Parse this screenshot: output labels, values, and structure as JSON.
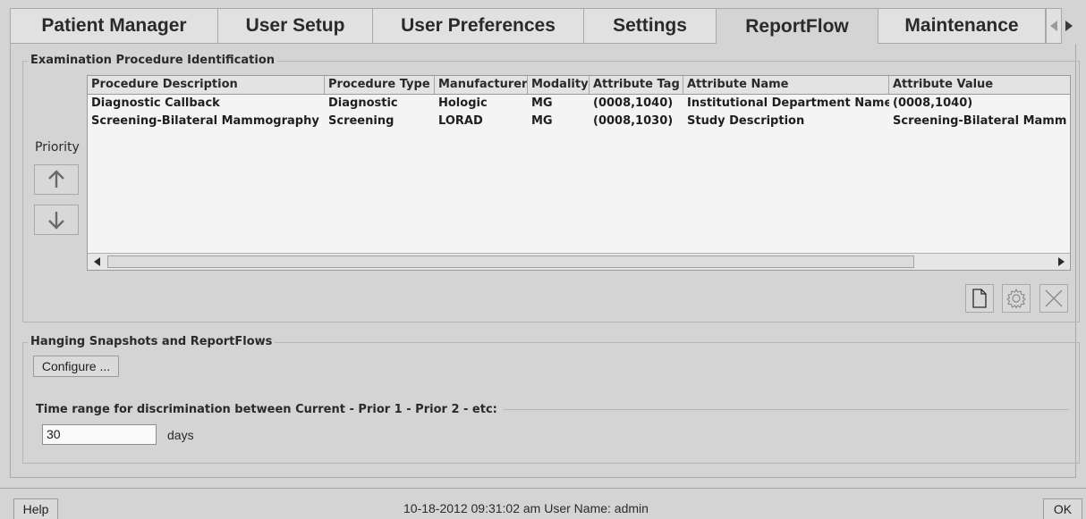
{
  "tabs": [
    {
      "label": "Patient Manager"
    },
    {
      "label": "User Setup"
    },
    {
      "label": "User Preferences"
    },
    {
      "label": "Settings"
    },
    {
      "label": "ReportFlow"
    },
    {
      "label": "Maintenance"
    }
  ],
  "active_tab": "ReportFlow",
  "exam_group": {
    "title": "Examination Procedure Identification",
    "priority_label": "Priority",
    "columns": [
      "Procedure Description",
      "Procedure Type",
      "Manufacturer",
      "Modality",
      "Attribute Tag",
      "Attribute Name",
      "Attribute Value"
    ],
    "rows": [
      [
        "Diagnostic Callback",
        "Diagnostic",
        "Hologic",
        "MG",
        "(0008,1040)",
        "Institutional Department Name",
        "(0008,1040)"
      ],
      [
        "Screening-Bilateral Mammography",
        "Screening",
        "LORAD",
        "MG",
        "(0008,1030)",
        "Study Description",
        "Screening-Bilateral Mamm"
      ]
    ]
  },
  "hanging_group": {
    "title": "Hanging Snapshots and ReportFlows",
    "configure_label": "Configure ...",
    "time_range_label": "Time range for discrimination between Current - Prior 1 - Prior 2 - etc:",
    "time_value": "30",
    "time_unit": "days"
  },
  "status_bar": {
    "help_label": "Help",
    "status_text": "10-18-2012  09:31:02 am  User Name:  admin",
    "ok_label": "OK"
  }
}
